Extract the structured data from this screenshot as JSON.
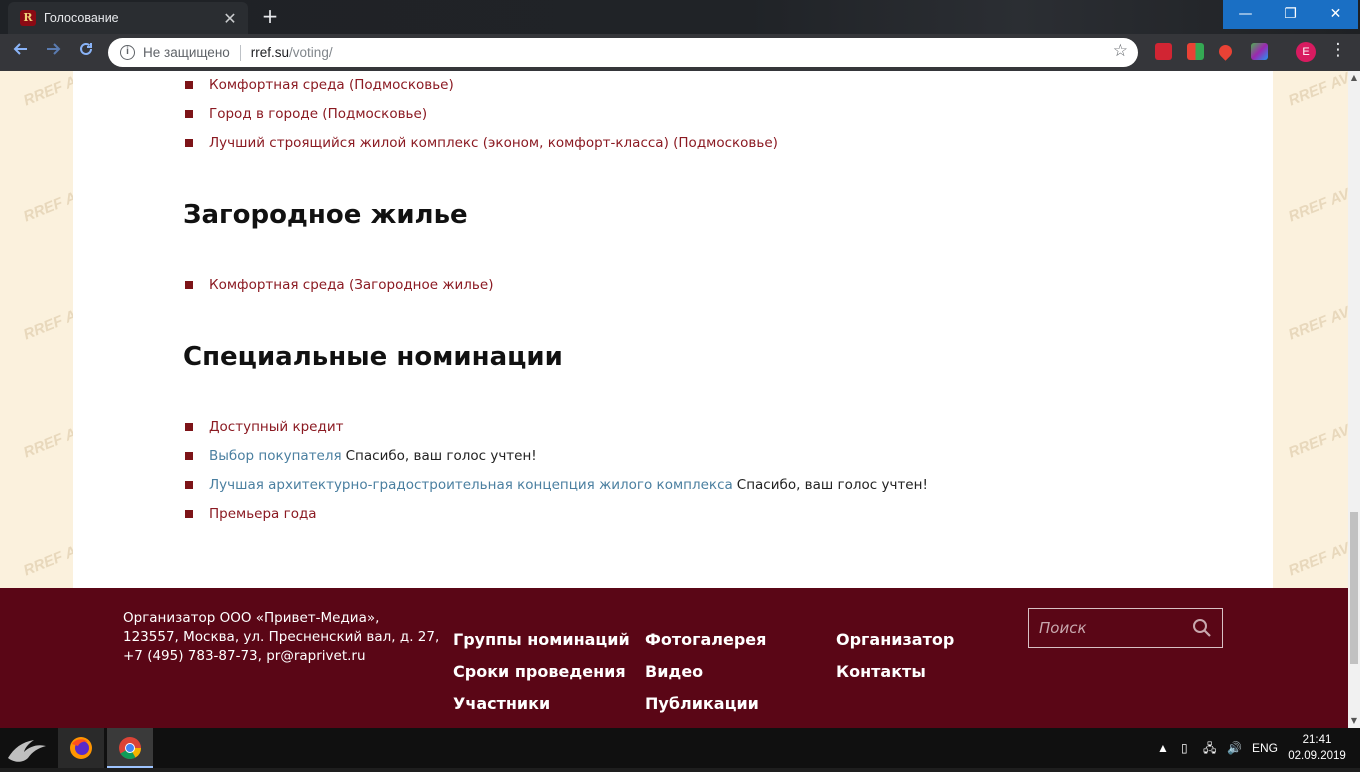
{
  "browser": {
    "tab_title": "Голосование",
    "tab_close": "✕",
    "new_tab": "+",
    "security_text": "Не защищено",
    "url_host": "rref.su",
    "url_path": "/voting/",
    "profile_initial": "E",
    "window_controls": {
      "minimize": "—",
      "maximize": "❐",
      "close": "✕"
    }
  },
  "watermark": "RREF AV",
  "sections": {
    "top_items": [
      {
        "label": "Комфортная среда (Подмосковье)"
      },
      {
        "label": "Город в городе (Подмосковье)"
      },
      {
        "label": "Лучший строящийся жилой комплекс (эконом, комфорт-класса) (Подмосковье)"
      }
    ],
    "country": {
      "title": "Загородное жилье",
      "items": [
        {
          "label": "Комфортная среда (Загородное жилье)"
        }
      ]
    },
    "special": {
      "title": "Специальные номинации",
      "items": [
        {
          "label": "Доступный кредит",
          "note": ""
        },
        {
          "label": "Выбор покупателя",
          "note": "Спасибо, ваш голос учтен!"
        },
        {
          "label": "Лучшая архитектурно-градостроительная концепция жилого комплекса",
          "note": "Спасибо, ваш голос учтен!"
        },
        {
          "label": "Премьера года",
          "note": ""
        }
      ]
    }
  },
  "footer": {
    "org_line1": "Организатор ООО «Привет-Медиа»,",
    "org_line2": "123557, Москва, ул. Пресненский вал, д. 27,",
    "org_line3": "+7 (495) 783-87-73, pr@raprivet.ru",
    "links": {
      "groups": "Группы номинаций",
      "dates": "Сроки проведения",
      "participants": "Участники",
      "gallery": "Фотогалерея",
      "video": "Видео",
      "publications": "Публикации",
      "organizer": "Организатор",
      "contacts": "Контакты"
    },
    "search_placeholder": "Поиск"
  },
  "taskbar": {
    "lang": "ENG",
    "time": "21:41",
    "date": "02.09.2019"
  },
  "colors": {
    "accent": "#8b1a22",
    "voted_link": "#4a7fa0",
    "footer_bg": "#5a0616",
    "page_bg": "#fbf1dd"
  }
}
